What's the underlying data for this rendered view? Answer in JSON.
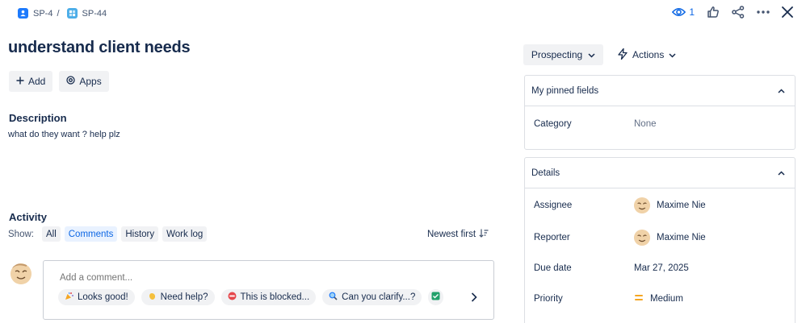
{
  "breadcrumbs": [
    {
      "label": "SP-4",
      "icon": "subtask-icon"
    },
    {
      "label": "SP-44",
      "icon": "task-icon"
    }
  ],
  "breadcrumb_separator": "/",
  "toolbar": {
    "watch_count": "1",
    "icons": [
      "eye-icon",
      "thumbs-up-icon",
      "share-icon",
      "more-icon",
      "close-icon"
    ]
  },
  "issue": {
    "title": "understand client needs",
    "add_label": "Add",
    "apps_label": "Apps"
  },
  "description": {
    "heading": "Description",
    "text": "what do they want ?  help plz"
  },
  "activity": {
    "heading": "Activity",
    "show_label": "Show:",
    "filters": [
      "All",
      "Comments",
      "History",
      "Work log"
    ],
    "active_filter": "Comments",
    "sort_label": "Newest first",
    "comment_placeholder": "Add a comment...",
    "quick_replies": [
      "Looks good!",
      "Need help?",
      "This is blocked...",
      "Can you clarify...?"
    ]
  },
  "status": {
    "label": "Prospecting",
    "actions_label": "Actions"
  },
  "pinned": {
    "heading": "My pinned fields",
    "fields": [
      {
        "label": "Category",
        "value": "None"
      }
    ]
  },
  "details": {
    "heading": "Details",
    "assignee_label": "Assignee",
    "assignee": "Maxime Nie",
    "reporter_label": "Reporter",
    "reporter": "Maxime Nie",
    "due_label": "Due date",
    "due": "Mar 27, 2025",
    "priority_label": "Priority",
    "priority": "Medium"
  },
  "colors": {
    "accent": "#0c66e4",
    "priority_medium": "#f5a623",
    "subtask_icon": "#1d7afc",
    "task_icon": "#4bade8"
  }
}
